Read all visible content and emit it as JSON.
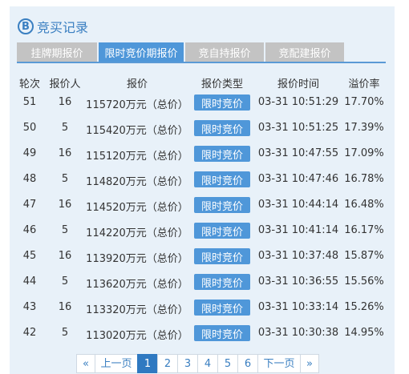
{
  "title": "竞买记录",
  "logo_glyph": "B",
  "tabs": [
    "挂牌期报价",
    "限时竞价期报价",
    "竞自持报价",
    "竞配建报价"
  ],
  "active_tab": 1,
  "columns": [
    "轮次",
    "报价人",
    "报价",
    "报价类型",
    "报价时间",
    "溢价率"
  ],
  "rows": [
    {
      "round": "51",
      "bidder": "16",
      "price": "115720万元（总价）",
      "type": "限时竞价",
      "time": "03-31 10:51:29",
      "premium": "17.70%"
    },
    {
      "round": "50",
      "bidder": "5",
      "price": "115420万元（总价）",
      "type": "限时竞价",
      "time": "03-31 10:51:25",
      "premium": "17.39%"
    },
    {
      "round": "49",
      "bidder": "16",
      "price": "115120万元（总价）",
      "type": "限时竞价",
      "time": "03-31 10:47:55",
      "premium": "17.09%"
    },
    {
      "round": "48",
      "bidder": "5",
      "price": "114820万元（总价）",
      "type": "限时竞价",
      "time": "03-31 10:47:46",
      "premium": "16.78%"
    },
    {
      "round": "47",
      "bidder": "16",
      "price": "114520万元（总价）",
      "type": "限时竞价",
      "time": "03-31 10:44:14",
      "premium": "16.48%"
    },
    {
      "round": "46",
      "bidder": "5",
      "price": "114220万元（总价）",
      "type": "限时竞价",
      "time": "03-31 10:41:14",
      "premium": "16.17%"
    },
    {
      "round": "45",
      "bidder": "16",
      "price": "113920万元（总价）",
      "type": "限时竞价",
      "time": "03-31 10:37:48",
      "premium": "15.87%"
    },
    {
      "round": "44",
      "bidder": "5",
      "price": "113620万元（总价）",
      "type": "限时竞价",
      "time": "03-31 10:36:55",
      "premium": "15.56%"
    },
    {
      "round": "43",
      "bidder": "16",
      "price": "113320万元（总价）",
      "type": "限时竞价",
      "time": "03-31 10:33:14",
      "premium": "15.26%"
    },
    {
      "round": "42",
      "bidder": "5",
      "price": "113020万元（总价）",
      "type": "限时竞价",
      "time": "03-31 10:30:38",
      "premium": "14.95%"
    }
  ],
  "pagination": {
    "first": "«",
    "prev": "上一页",
    "pages": [
      "1",
      "2",
      "3",
      "4",
      "5",
      "6"
    ],
    "current": "1",
    "next": "下一页",
    "last": "»"
  },
  "colors": {
    "accent": "#4f97d9",
    "tab_inactive": "#c3c3c3",
    "panel": "#e8f1f9",
    "title": "#3a7fc1"
  }
}
